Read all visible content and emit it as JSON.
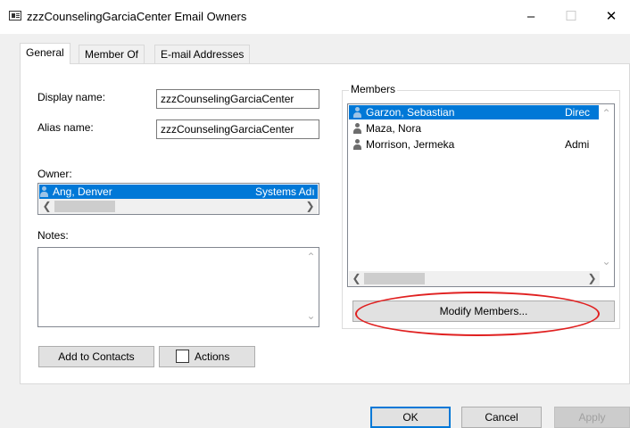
{
  "window": {
    "title": "zzzCounselingGarciaCenter Email Owners",
    "minimize_glyph": "–",
    "maximize_glyph": "☐",
    "close_glyph": "✕"
  },
  "tabs": [
    {
      "label": "General",
      "active": true
    },
    {
      "label": "Member Of",
      "active": false
    },
    {
      "label": "E-mail Addresses",
      "active": false
    }
  ],
  "general": {
    "display_name_label": "Display name:",
    "display_name_value": "zzzCounselingGarciaCenter",
    "alias_name_label": "Alias name:",
    "alias_name_value": "zzzCounselingGarciaCenter",
    "owner_label": "Owner:",
    "owner": {
      "name": "Ang, Denver",
      "title": "Systems Adı"
    },
    "notes_label": "Notes:",
    "notes_value": ""
  },
  "members": {
    "group_label": "Members",
    "items": [
      {
        "name": "Garzon, Sebastian",
        "title": "Direc",
        "selected": true
      },
      {
        "name": "Maza, Nora",
        "title": "",
        "selected": false
      },
      {
        "name": "Morrison, Jermeka",
        "title": "Admi",
        "selected": false
      }
    ],
    "modify_button": "Modify Members..."
  },
  "buttons": {
    "add_to_contacts": "Add to Contacts",
    "actions": "Actions",
    "ok": "OK",
    "cancel": "Cancel",
    "apply": "Apply"
  },
  "scroll": {
    "left_arrow": "❮",
    "right_arrow": "❯",
    "up_arrow": "⌃",
    "down_arrow": "⌄"
  },
  "annotation": {
    "color": "#e02020"
  },
  "colors": {
    "selection": "#0078d7",
    "dialog_bg": "#f0f0f0"
  }
}
